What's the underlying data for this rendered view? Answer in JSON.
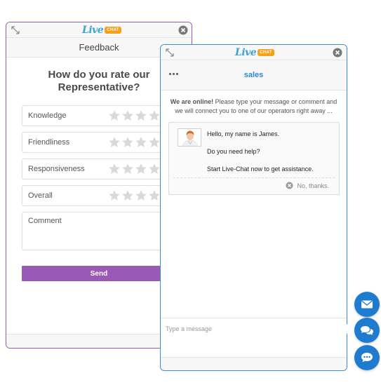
{
  "feedback": {
    "logo_text": "Live",
    "logo_badge": "CHAT",
    "header": "Feedback",
    "question": "How do you rate our Representative?",
    "ratings": [
      {
        "label": "Knowledge",
        "stars": 0
      },
      {
        "label": "Friendliness",
        "stars": 0
      },
      {
        "label": "Responsiveness",
        "stars": 0
      },
      {
        "label": "Overall",
        "stars": 0
      }
    ],
    "max_stars": 5,
    "comment_label": "Comment",
    "send_label": "Send",
    "accent_color": "#9b59b6"
  },
  "chat": {
    "logo_text": "Live",
    "logo_badge": "CHAT",
    "title": "sales",
    "online_bold": "We are online!",
    "online_text": " Please type your message or comment and we will connect you to one of our operators right away ...",
    "messages": [
      "Hello, my name is James.",
      "Do you need help?",
      "Start Live-Chat now to get assistance."
    ],
    "no_thanks": "No, thanks.",
    "input_placeholder": "Type a message",
    "accent_color": "#2f8ad0"
  },
  "fabs": [
    {
      "name": "email-fab",
      "icon": "envelope-icon"
    },
    {
      "name": "chat-fab",
      "icon": "speech-bubbles-icon"
    },
    {
      "name": "message-fab",
      "icon": "speech-bubble-dots-icon"
    }
  ]
}
